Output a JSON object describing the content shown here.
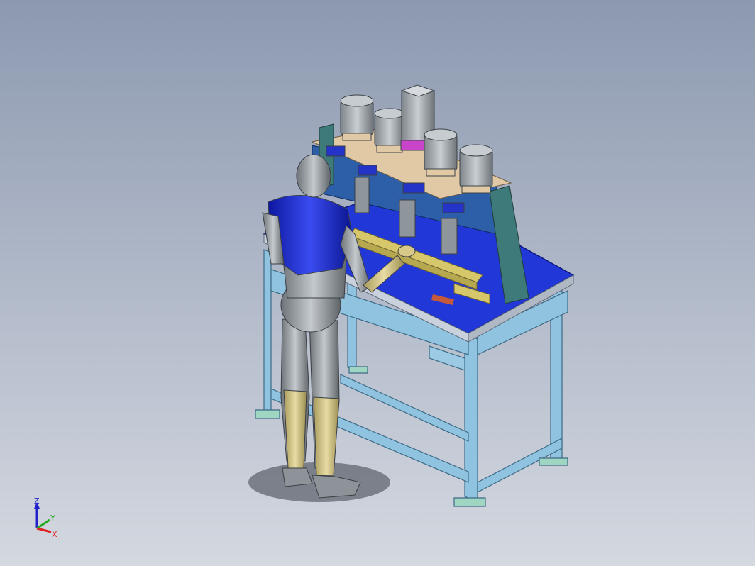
{
  "viewport": {
    "background_top": "#8c99b0",
    "background_bottom": "#d4d8e0"
  },
  "colors": {
    "frame": "#8fc3e0",
    "tabletop": "#2237d8",
    "plate": "#2d5fa8",
    "motor": "#a8aeb2",
    "mannequin_body": "#9ea4aa",
    "mannequin_vest": "#1a2ad8",
    "mannequin_skin": "#d8c98a",
    "rail": "#d6c86a",
    "gusset": "#3f7a7a"
  },
  "triad": {
    "x_label": "X",
    "y_label": "Y",
    "z_label": "Z",
    "x_color": "#d22",
    "y_color": "#2a2",
    "z_color": "#22c"
  }
}
